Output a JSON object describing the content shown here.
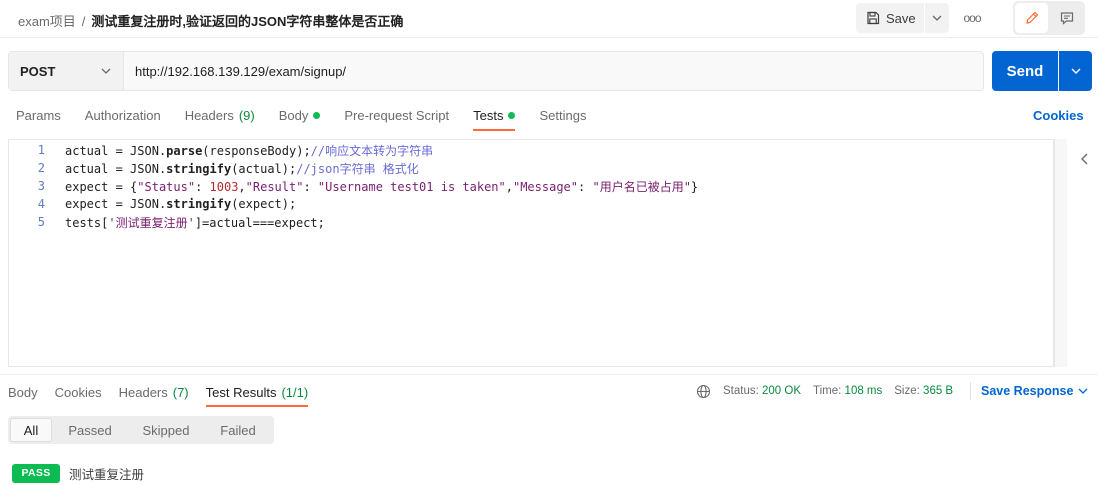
{
  "header": {
    "parent": "exam项目",
    "separator": "/",
    "title": "测试重复注册时,验证返回的JSON字符串整体是否正确",
    "save_label": "Save",
    "more_label": "ooo"
  },
  "request": {
    "method": "POST",
    "url": "http://192.168.139.129/exam/signup/",
    "send_label": "Send"
  },
  "req_tabs": {
    "params": "Params",
    "authorization": "Authorization",
    "headers": "Headers",
    "headers_count": "(9)",
    "body": "Body",
    "prerequest": "Pre-request Script",
    "tests": "Tests",
    "settings": "Settings",
    "cookies": "Cookies"
  },
  "editor": {
    "line_numbers": [
      "1",
      "2",
      "3",
      "4",
      "5"
    ],
    "line1": {
      "kw": "actual",
      "op": " = ",
      "obj": "JSON.",
      "fn": "parse",
      "args": "(responseBody);",
      "comment": "//响应文本转为字符串"
    },
    "line2": {
      "kw": "actual",
      "op": " = ",
      "obj": "JSON.",
      "fn": "stringify",
      "args": "(actual);",
      "comment": "//json字符串 格式化"
    },
    "line3": {
      "kw": "expect",
      "op": " = {",
      "k1": "\"Status\"",
      "c1": ": ",
      "v1": "1003",
      "c2": ",",
      "k2": "\"Result\"",
      "c3": ": ",
      "v2": "\"Username test01 is taken\"",
      "c4": ",",
      "k3": "\"Message\"",
      "c5": ": ",
      "v3": "\"用户名已被占用\"",
      "end": "}"
    },
    "line4": {
      "kw": "expect",
      "op": " = ",
      "obj": "JSON.",
      "fn": "stringify",
      "args": "(expect);"
    },
    "line5": {
      "pre": "tests[",
      "str": "'测试重复注册'",
      "post": "]=actual===expect;"
    }
  },
  "response": {
    "tabs": {
      "body": "Body",
      "cookies": "Cookies",
      "headers": "Headers",
      "headers_count": "(7)",
      "test_results": "Test Results",
      "test_results_count": "(1/1)"
    },
    "status_label": "Status:",
    "status_value": "200 OK",
    "time_label": "Time:",
    "time_value": "108 ms",
    "size_label": "Size:",
    "size_value": "365 B",
    "save_response": "Save Response"
  },
  "filters": [
    "All",
    "Passed",
    "Skipped",
    "Failed"
  ],
  "results": [
    {
      "badge": "PASS",
      "name": "测试重复注册"
    }
  ],
  "colors": {
    "accent_orange": "#ff6c37",
    "primary_blue": "#0265d2",
    "success_green": "#0cbb52"
  }
}
